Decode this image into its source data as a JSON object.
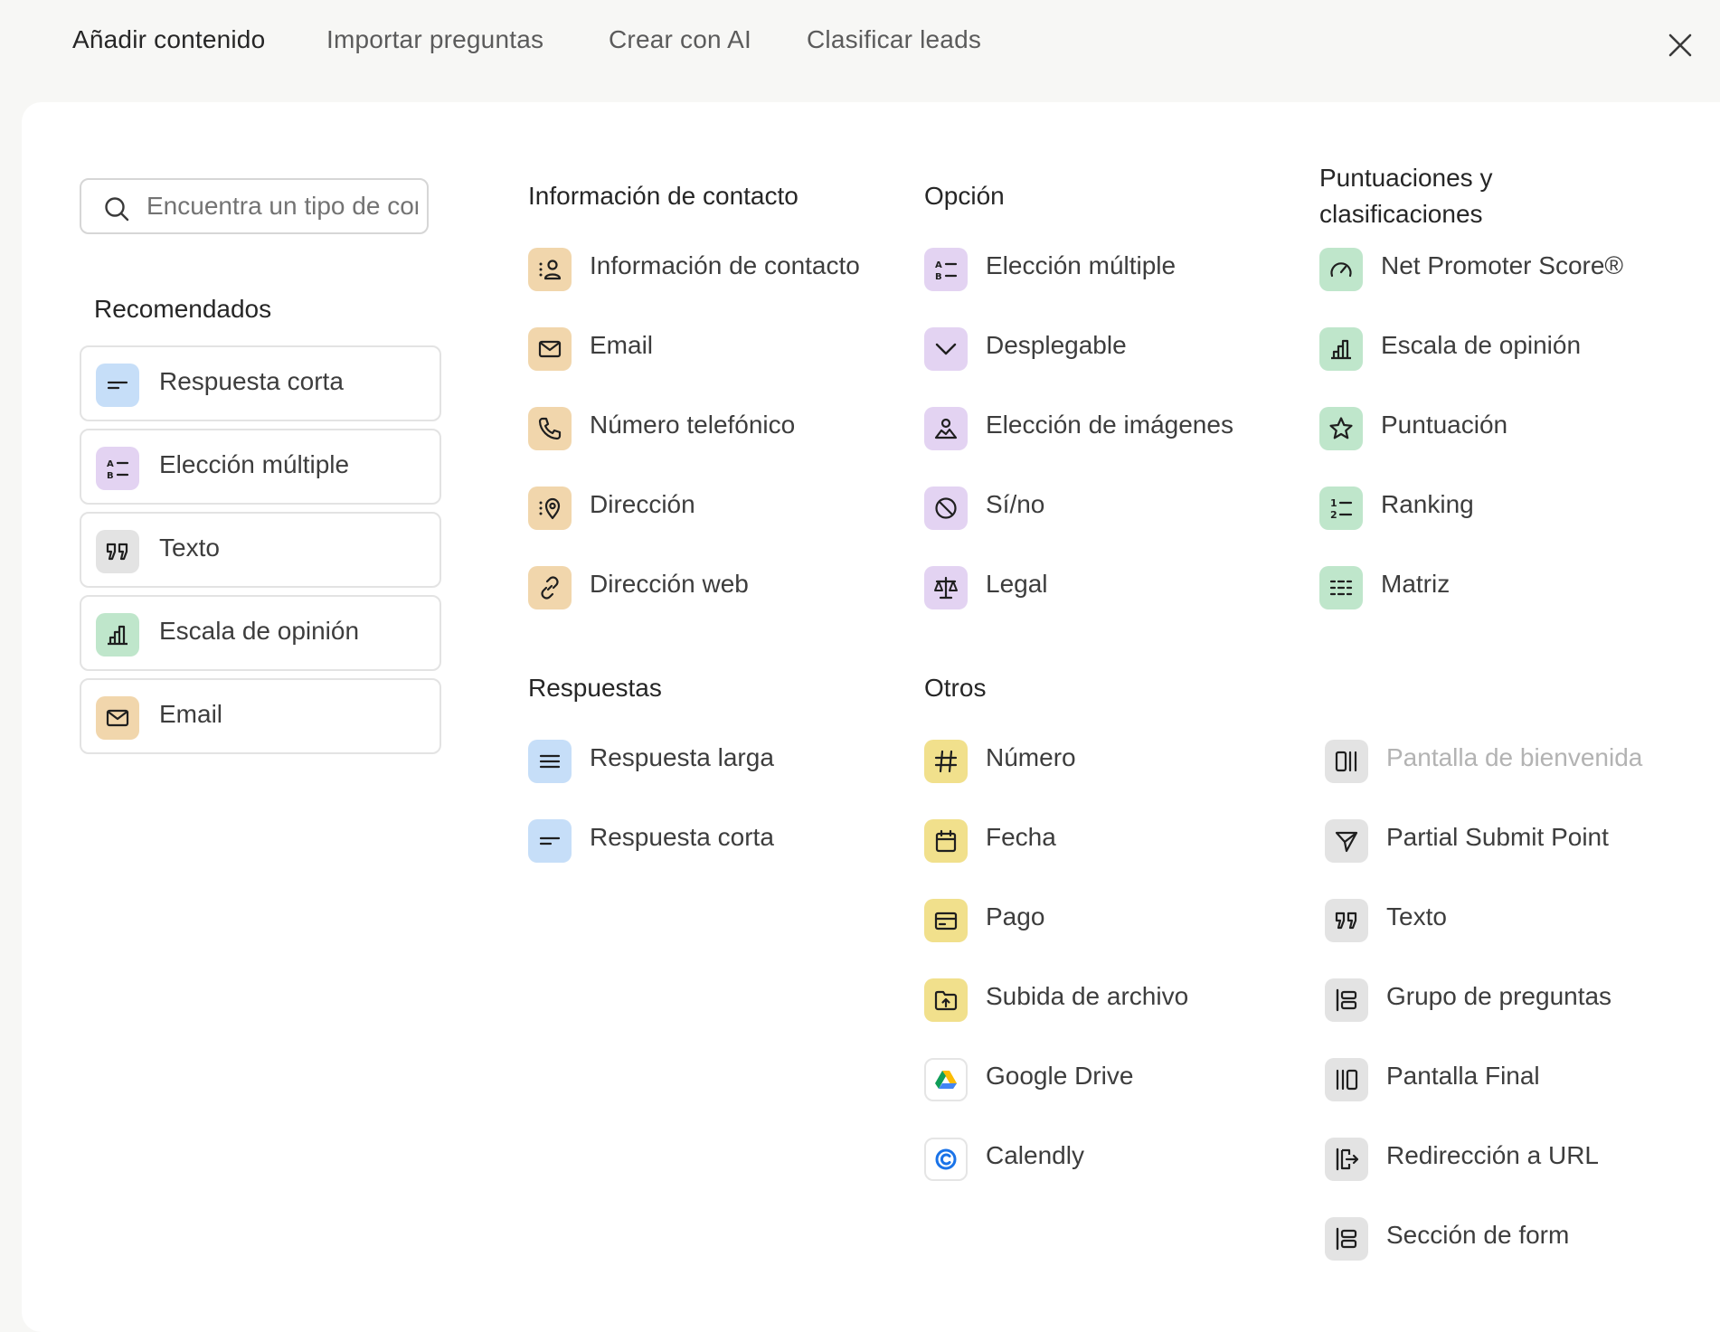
{
  "tabs": [
    {
      "label": "Añadir contenido"
    },
    {
      "label": "Importar preguntas"
    },
    {
      "label": "Crear con AI"
    },
    {
      "label": "Clasificar leads"
    }
  ],
  "search": {
    "placeholder": "Encuentra un tipo de contenido"
  },
  "recommended": {
    "title": "Recomendados",
    "items": [
      {
        "label": "Respuesta corta",
        "icon": "short-text-icon",
        "color": "#c6def8"
      },
      {
        "label": "Elección múltiple",
        "icon": "multiple-choice-icon",
        "color": "#e3d3f2"
      },
      {
        "label": "Texto",
        "icon": "quote-icon",
        "color": "#e3e3e3"
      },
      {
        "label": "Escala de opinión",
        "icon": "opinion-scale-icon",
        "color": "#bfe6cb"
      },
      {
        "label": "Email",
        "icon": "email-icon",
        "color": "#f1d6ac"
      }
    ]
  },
  "contact": {
    "title": "Información de contacto",
    "items": [
      {
        "label": "Información de contacto",
        "icon": "contact-info-icon"
      },
      {
        "label": "Email",
        "icon": "email-icon"
      },
      {
        "label": "Número telefónico",
        "icon": "phone-icon"
      },
      {
        "label": "Dirección",
        "icon": "address-icon"
      },
      {
        "label": "Dirección web",
        "icon": "link-icon"
      }
    ]
  },
  "choice": {
    "title": "Opción",
    "items": [
      {
        "label": "Elección múltiple",
        "icon": "multiple-choice-icon"
      },
      {
        "label": "Desplegable",
        "icon": "chevron-down-icon"
      },
      {
        "label": "Elección de imágenes",
        "icon": "picture-choice-icon"
      },
      {
        "label": "Sí/no",
        "icon": "yes-no-icon"
      },
      {
        "label": "Legal",
        "icon": "scales-icon"
      }
    ]
  },
  "ratings": {
    "title_line1": "Puntuaciones y",
    "title_line2": "clasificaciones",
    "items": [
      {
        "label": "Net Promoter Score®",
        "icon": "gauge-icon"
      },
      {
        "label": "Escala de opinión",
        "icon": "opinion-scale-icon"
      },
      {
        "label": "Puntuación",
        "icon": "star-icon"
      },
      {
        "label": "Ranking",
        "icon": "ranking-icon"
      },
      {
        "label": "Matriz",
        "icon": "matrix-icon"
      }
    ]
  },
  "answers": {
    "title": "Respuestas",
    "items": [
      {
        "label": "Respuesta larga",
        "icon": "long-text-icon"
      },
      {
        "label": "Respuesta corta",
        "icon": "short-text-icon"
      }
    ]
  },
  "others": {
    "title": "Otros",
    "items": [
      {
        "label": "Número",
        "icon": "hash-icon"
      },
      {
        "label": "Fecha",
        "icon": "calendar-icon"
      },
      {
        "label": "Pago",
        "icon": "credit-card-icon"
      },
      {
        "label": "Subida de archivo",
        "icon": "file-upload-icon"
      },
      {
        "label": "Google Drive",
        "icon": "google-drive-icon"
      },
      {
        "label": "Calendly",
        "icon": "calendly-icon"
      }
    ]
  },
  "structure": {
    "items": [
      {
        "label": "Pantalla de bienvenida",
        "icon": "welcome-screen-icon",
        "disabled": true
      },
      {
        "label": "Partial Submit Point",
        "icon": "send-icon"
      },
      {
        "label": "Texto",
        "icon": "quote-icon"
      },
      {
        "label": "Grupo de preguntas",
        "icon": "question-group-icon"
      },
      {
        "label": "Pantalla Final",
        "icon": "end-screen-icon"
      },
      {
        "label": "Redirección a URL",
        "icon": "redirect-icon"
      },
      {
        "label": "Sección de form",
        "icon": "form-section-icon"
      }
    ]
  }
}
